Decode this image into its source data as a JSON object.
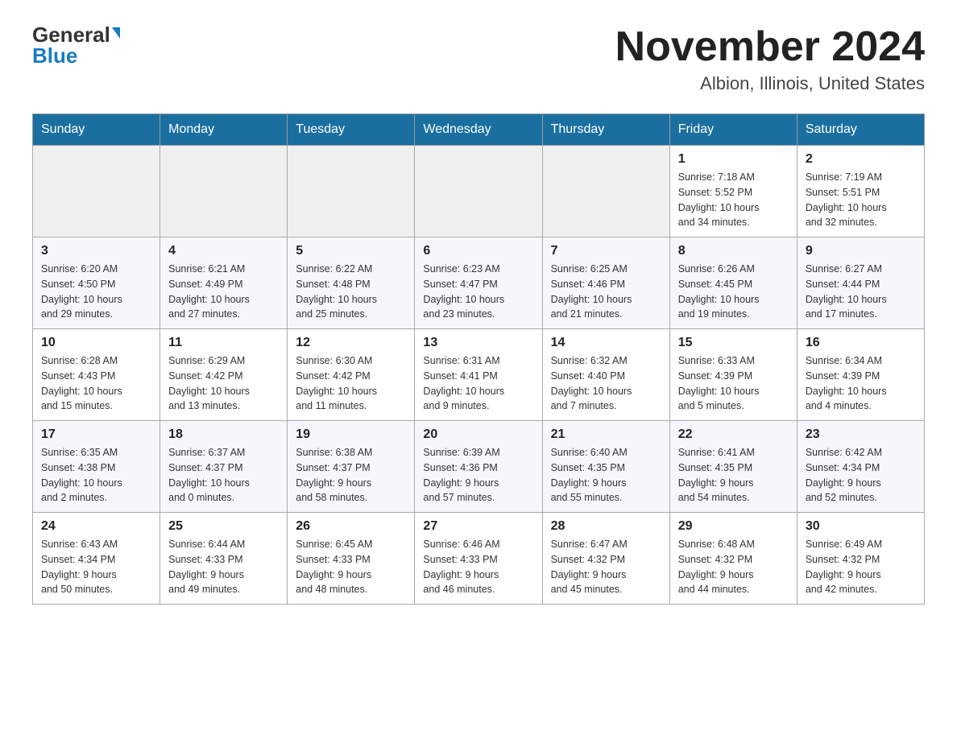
{
  "header": {
    "logo_general": "General",
    "logo_blue": "Blue",
    "month_title": "November 2024",
    "location": "Albion, Illinois, United States"
  },
  "days_of_week": [
    "Sunday",
    "Monday",
    "Tuesday",
    "Wednesday",
    "Thursday",
    "Friday",
    "Saturday"
  ],
  "weeks": [
    [
      {
        "day": "",
        "info": ""
      },
      {
        "day": "",
        "info": ""
      },
      {
        "day": "",
        "info": ""
      },
      {
        "day": "",
        "info": ""
      },
      {
        "day": "",
        "info": ""
      },
      {
        "day": "1",
        "info": "Sunrise: 7:18 AM\nSunset: 5:52 PM\nDaylight: 10 hours\nand 34 minutes."
      },
      {
        "day": "2",
        "info": "Sunrise: 7:19 AM\nSunset: 5:51 PM\nDaylight: 10 hours\nand 32 minutes."
      }
    ],
    [
      {
        "day": "3",
        "info": "Sunrise: 6:20 AM\nSunset: 4:50 PM\nDaylight: 10 hours\nand 29 minutes."
      },
      {
        "day": "4",
        "info": "Sunrise: 6:21 AM\nSunset: 4:49 PM\nDaylight: 10 hours\nand 27 minutes."
      },
      {
        "day": "5",
        "info": "Sunrise: 6:22 AM\nSunset: 4:48 PM\nDaylight: 10 hours\nand 25 minutes."
      },
      {
        "day": "6",
        "info": "Sunrise: 6:23 AM\nSunset: 4:47 PM\nDaylight: 10 hours\nand 23 minutes."
      },
      {
        "day": "7",
        "info": "Sunrise: 6:25 AM\nSunset: 4:46 PM\nDaylight: 10 hours\nand 21 minutes."
      },
      {
        "day": "8",
        "info": "Sunrise: 6:26 AM\nSunset: 4:45 PM\nDaylight: 10 hours\nand 19 minutes."
      },
      {
        "day": "9",
        "info": "Sunrise: 6:27 AM\nSunset: 4:44 PM\nDaylight: 10 hours\nand 17 minutes."
      }
    ],
    [
      {
        "day": "10",
        "info": "Sunrise: 6:28 AM\nSunset: 4:43 PM\nDaylight: 10 hours\nand 15 minutes."
      },
      {
        "day": "11",
        "info": "Sunrise: 6:29 AM\nSunset: 4:42 PM\nDaylight: 10 hours\nand 13 minutes."
      },
      {
        "day": "12",
        "info": "Sunrise: 6:30 AM\nSunset: 4:42 PM\nDaylight: 10 hours\nand 11 minutes."
      },
      {
        "day": "13",
        "info": "Sunrise: 6:31 AM\nSunset: 4:41 PM\nDaylight: 10 hours\nand 9 minutes."
      },
      {
        "day": "14",
        "info": "Sunrise: 6:32 AM\nSunset: 4:40 PM\nDaylight: 10 hours\nand 7 minutes."
      },
      {
        "day": "15",
        "info": "Sunrise: 6:33 AM\nSunset: 4:39 PM\nDaylight: 10 hours\nand 5 minutes."
      },
      {
        "day": "16",
        "info": "Sunrise: 6:34 AM\nSunset: 4:39 PM\nDaylight: 10 hours\nand 4 minutes."
      }
    ],
    [
      {
        "day": "17",
        "info": "Sunrise: 6:35 AM\nSunset: 4:38 PM\nDaylight: 10 hours\nand 2 minutes."
      },
      {
        "day": "18",
        "info": "Sunrise: 6:37 AM\nSunset: 4:37 PM\nDaylight: 10 hours\nand 0 minutes."
      },
      {
        "day": "19",
        "info": "Sunrise: 6:38 AM\nSunset: 4:37 PM\nDaylight: 9 hours\nand 58 minutes."
      },
      {
        "day": "20",
        "info": "Sunrise: 6:39 AM\nSunset: 4:36 PM\nDaylight: 9 hours\nand 57 minutes."
      },
      {
        "day": "21",
        "info": "Sunrise: 6:40 AM\nSunset: 4:35 PM\nDaylight: 9 hours\nand 55 minutes."
      },
      {
        "day": "22",
        "info": "Sunrise: 6:41 AM\nSunset: 4:35 PM\nDaylight: 9 hours\nand 54 minutes."
      },
      {
        "day": "23",
        "info": "Sunrise: 6:42 AM\nSunset: 4:34 PM\nDaylight: 9 hours\nand 52 minutes."
      }
    ],
    [
      {
        "day": "24",
        "info": "Sunrise: 6:43 AM\nSunset: 4:34 PM\nDaylight: 9 hours\nand 50 minutes."
      },
      {
        "day": "25",
        "info": "Sunrise: 6:44 AM\nSunset: 4:33 PM\nDaylight: 9 hours\nand 49 minutes."
      },
      {
        "day": "26",
        "info": "Sunrise: 6:45 AM\nSunset: 4:33 PM\nDaylight: 9 hours\nand 48 minutes."
      },
      {
        "day": "27",
        "info": "Sunrise: 6:46 AM\nSunset: 4:33 PM\nDaylight: 9 hours\nand 46 minutes."
      },
      {
        "day": "28",
        "info": "Sunrise: 6:47 AM\nSunset: 4:32 PM\nDaylight: 9 hours\nand 45 minutes."
      },
      {
        "day": "29",
        "info": "Sunrise: 6:48 AM\nSunset: 4:32 PM\nDaylight: 9 hours\nand 44 minutes."
      },
      {
        "day": "30",
        "info": "Sunrise: 6:49 AM\nSunset: 4:32 PM\nDaylight: 9 hours\nand 42 minutes."
      }
    ]
  ]
}
